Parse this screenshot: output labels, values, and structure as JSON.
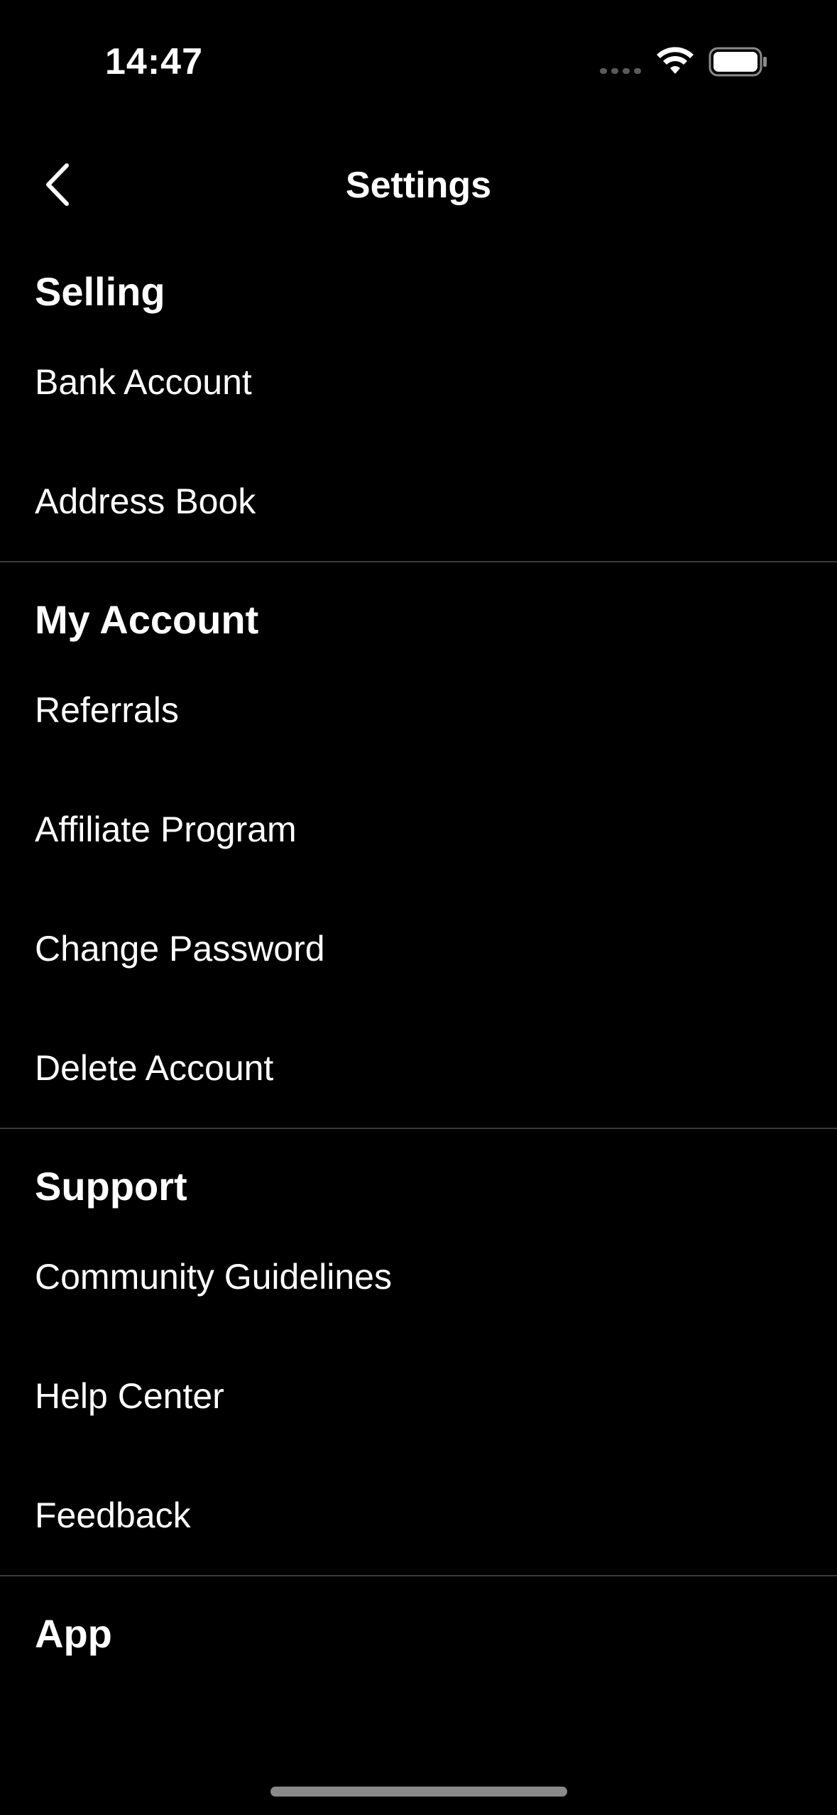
{
  "status_bar": {
    "time": "14:47"
  },
  "nav": {
    "title": "Settings"
  },
  "sections": [
    {
      "title": "Selling",
      "items": [
        "Bank Account",
        "Address Book"
      ]
    },
    {
      "title": "My Account",
      "items": [
        "Referrals",
        "Affiliate Program",
        "Change Password",
        "Delete Account"
      ]
    },
    {
      "title": "Support",
      "items": [
        "Community Guidelines",
        "Help Center",
        "Feedback"
      ]
    },
    {
      "title": "App",
      "items": []
    }
  ],
  "colors": {
    "background": "#000000",
    "text": "#ffffff",
    "divider": "#3a3a3a",
    "home_indicator": "#8a8a8a"
  },
  "icons": {
    "back": "chevron-left-icon",
    "wifi": "wifi-icon",
    "battery": "battery-icon",
    "cellular": "cellular-signal-icon"
  }
}
